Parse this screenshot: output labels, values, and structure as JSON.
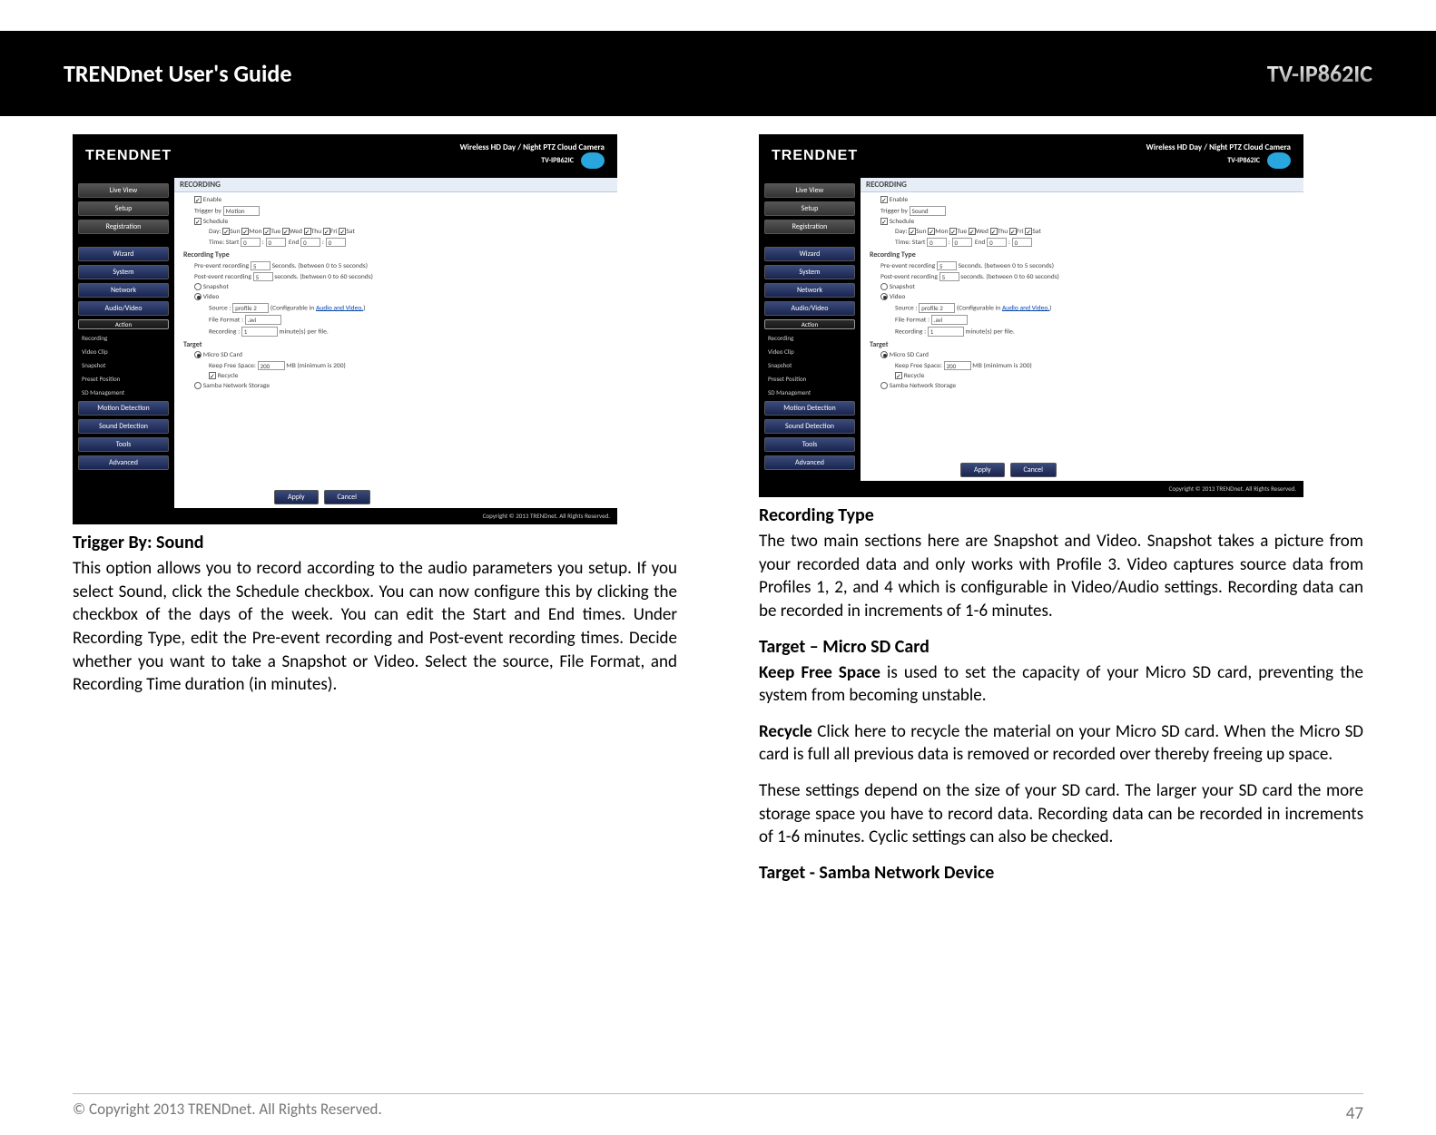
{
  "header": {
    "left": "TRENDnet User's Guide",
    "right": "TV-IP862IC"
  },
  "footer": {
    "copyright": "© Copyright 2013 TRENDnet. All Rights Reserved.",
    "page": "47"
  },
  "shot_common": {
    "brand": "TRENDNET",
    "tagline1": "Wireless HD Day / Night PTZ Cloud Camera",
    "tagline2": "TV-IP862IC",
    "panel_title": "RECORDING",
    "foot": "Copyright © 2013 TRENDnet. All Rights Reserved.",
    "apply": "Apply",
    "cancel": "Cancel",
    "nav_top": [
      "Live View",
      "Setup",
      "Registration"
    ],
    "nav": [
      "Wizard",
      "System",
      "Network",
      "Audio/Video",
      "Action"
    ],
    "nav_sub": [
      "Recording",
      "Video Clip",
      "Snapshot",
      "Preset Position",
      "SD Management"
    ],
    "nav2": [
      "Motion Detection",
      "Sound Detection",
      "Tools",
      "Advanced"
    ]
  },
  "shot_left": {
    "enable": "Enable",
    "trigger_label": "Trigger by",
    "trigger_value": "Motion",
    "schedule": "Schedule",
    "day_label": "Day:",
    "days": [
      "Sun",
      "Mon",
      "Tue",
      "Wed",
      "Thu",
      "Fri",
      "Sat"
    ],
    "time_label": "Time: Start",
    "time_start_h": "0",
    "time_start_m": "0",
    "time_end_label": "End",
    "time_end_h": "0",
    "time_end_m": "0",
    "rec_type": "Recording Type",
    "pre_label": "Pre-event recording",
    "pre_val": "5",
    "pre_hint": "Seconds. (between 0 to 5 seconds)",
    "post_label": "Post-event recording",
    "post_val": "5",
    "post_hint": "seconds. (between 0 to 60 seconds)",
    "snapshot": "Snapshot",
    "video": "Video",
    "source_label": "Source :",
    "source_val": "profile 2",
    "source_hint": "(Configurable in",
    "source_link": "Audio and Video.",
    "source_close": ")",
    "ff_label": "File Format :",
    "ff_val": ".avi",
    "recmin_label": "Recording :",
    "recmin_val": "1",
    "recmin_hint": "minute(s) per file.",
    "target": "Target",
    "sd": "Micro SD Card",
    "kfs_label": "Keep Free Space:",
    "kfs_val": "200",
    "kfs_hint": "MB (minimum is 200)",
    "recycle": "Recycle",
    "samba": "Samba Network Storage"
  },
  "shot_right": {
    "trigger_value": "Sound"
  },
  "left_text": {
    "h1": "Trigger By: Sound",
    "p1": "This option allows you to record according to the audio parameters you setup. If you select Sound, click the Schedule checkbox. You can now configure this by clicking the checkbox of the days of the week. You can edit the Start and End times. Under Recording Type, edit the Pre-event recording and Post-event recording times. Decide whether you want to take a Snapshot or Video. Select the source, File Format, and Recording Time duration (in minutes)."
  },
  "right_text": {
    "h1": "Recording Type",
    "p1": "The two main sections here are Snapshot and Video. Snapshot takes a picture from your recorded data and only works with Profile 3. Video captures source data from Profiles 1, 2, and 4 which is configurable in Video/Audio settings. Recording data can be recorded in increments of 1-6 minutes.",
    "h2": "Target – Micro SD Card",
    "kfs_b": "Keep Free Space",
    "kfs": " is used to set the capacity of your Micro SD card, preventing the system from becoming unstable.",
    "rec_b": "Recycle",
    "rec": " Click here to recycle the material on your Micro SD card. When the Micro SD card is full all previous data is removed or recorded over thereby freeing up space.",
    "p4": "These settings depend on the size of your SD card. The larger your SD card the more storage space you have to record data. Recording data can be recorded in increments of 1-6 minutes. Cyclic settings can also be checked.",
    "h3": "Target - Samba Network Device"
  }
}
